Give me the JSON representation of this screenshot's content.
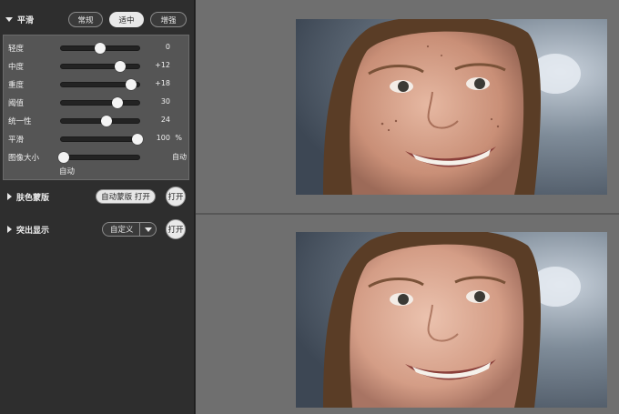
{
  "smooth_section": {
    "title": "平滑",
    "presets": [
      "常规",
      "适中",
      "增强"
    ],
    "active_preset": "适中",
    "sliders": [
      {
        "label": "轻度",
        "value_text": "0",
        "level": 0.5,
        "unit": ""
      },
      {
        "label": "中度",
        "value_text": "+12",
        "level": 0.76,
        "unit": ""
      },
      {
        "label": "重度",
        "value_text": "+18",
        "level": 0.9,
        "unit": ""
      },
      {
        "label": "阈值",
        "value_text": "30",
        "level": 0.72,
        "unit": ""
      },
      {
        "label": "统一性",
        "value_text": "24",
        "level": 0.58,
        "unit": ""
      },
      {
        "label": "平滑",
        "value_text": "100",
        "level": 0.98,
        "unit": "%"
      },
      {
        "label": "图像大小",
        "value_text": "自动",
        "level": 0.03,
        "unit": ""
      }
    ],
    "image_size_sublabel": "自动"
  },
  "skin_mask_section": {
    "title": "肤色蒙版",
    "auto_mask_button": "自动蒙版 打开",
    "toggle_button": "打开"
  },
  "highlight_section": {
    "title": "突出显示",
    "dropdown_value": "自定义",
    "toggle_button": "打开"
  },
  "colors": {
    "panel_bg": "#2e2e2e",
    "slider_box_bg": "#555555",
    "preview_bg": "#6f6f6f",
    "active_preset_bg": "#e9e9e9"
  }
}
